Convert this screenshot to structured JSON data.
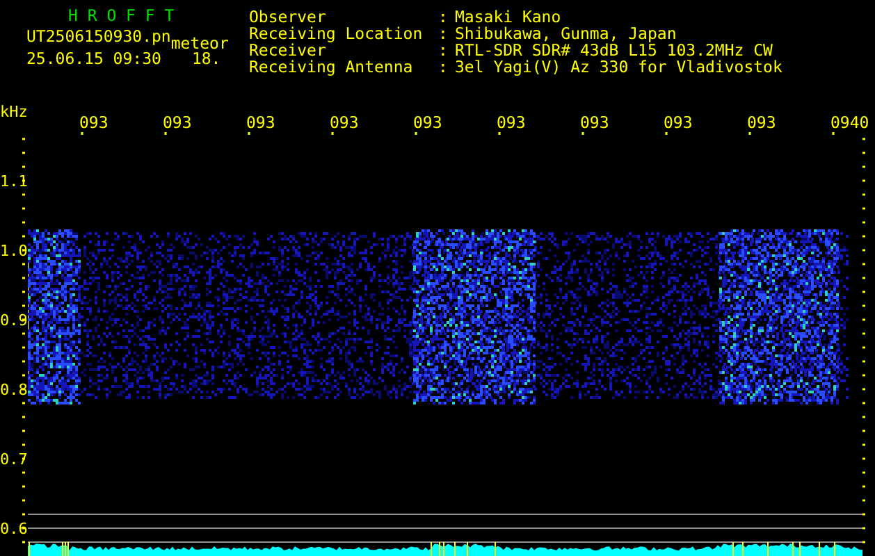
{
  "header": {
    "title": "H R O F F T",
    "file": "UT2506150930.pn",
    "tag": "meteor",
    "datetime": "25.06.15 09:30",
    "count": "18."
  },
  "station": [
    {
      "label": "Observer",
      "separator": ":",
      "value": "Masaki Kano"
    },
    {
      "label": "Receiving Location",
      "separator": ":",
      "value": "Shibukawa, Gunma, Japan"
    },
    {
      "label": "Receiver",
      "separator": ":",
      "value": "RTL-SDR SDR# 43dB L15 103.2MHz CW"
    },
    {
      "label": "Receiving Antenna",
      "separator": ":",
      "value": "3el Yagi(V) Az 330 for Vladivostok"
    }
  ],
  "axis": {
    "unit": "kHz",
    "y_labels": [
      "1.1",
      "1.0",
      "0.9",
      "0.8",
      "0.7",
      "0.6"
    ],
    "time_labels": [
      "093",
      "093",
      "093",
      "093",
      "093",
      "093",
      "093",
      "093",
      "093",
      "0940"
    ]
  }
}
